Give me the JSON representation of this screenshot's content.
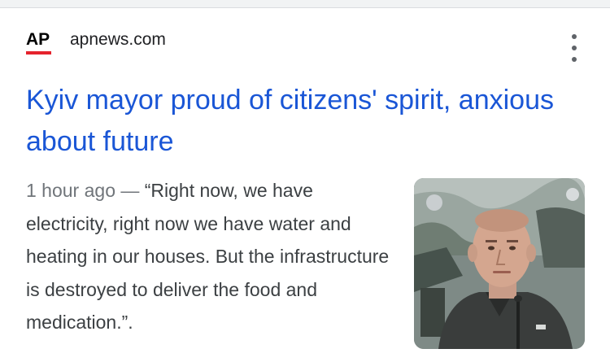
{
  "source": {
    "logo_text": "AP",
    "name": "apnews.com",
    "brand_red": "#e5232d"
  },
  "menu": {
    "icon": "more-vert-icon"
  },
  "article": {
    "headline": "Kyiv mayor proud of citizens' spirit, anxious about future",
    "timestamp": "1 hour ago",
    "separator": " — ",
    "snippet": "“Right now, we have electricity, right now we have water and heating in our houses. But the infrastructure is destroyed to deliver the food and medication.”.",
    "thumbnail": "news-photo-kyiv-mayor"
  },
  "colors": {
    "headline": "#1a56d6",
    "snippet": "#3c4043",
    "timestamp": "#70757a"
  }
}
